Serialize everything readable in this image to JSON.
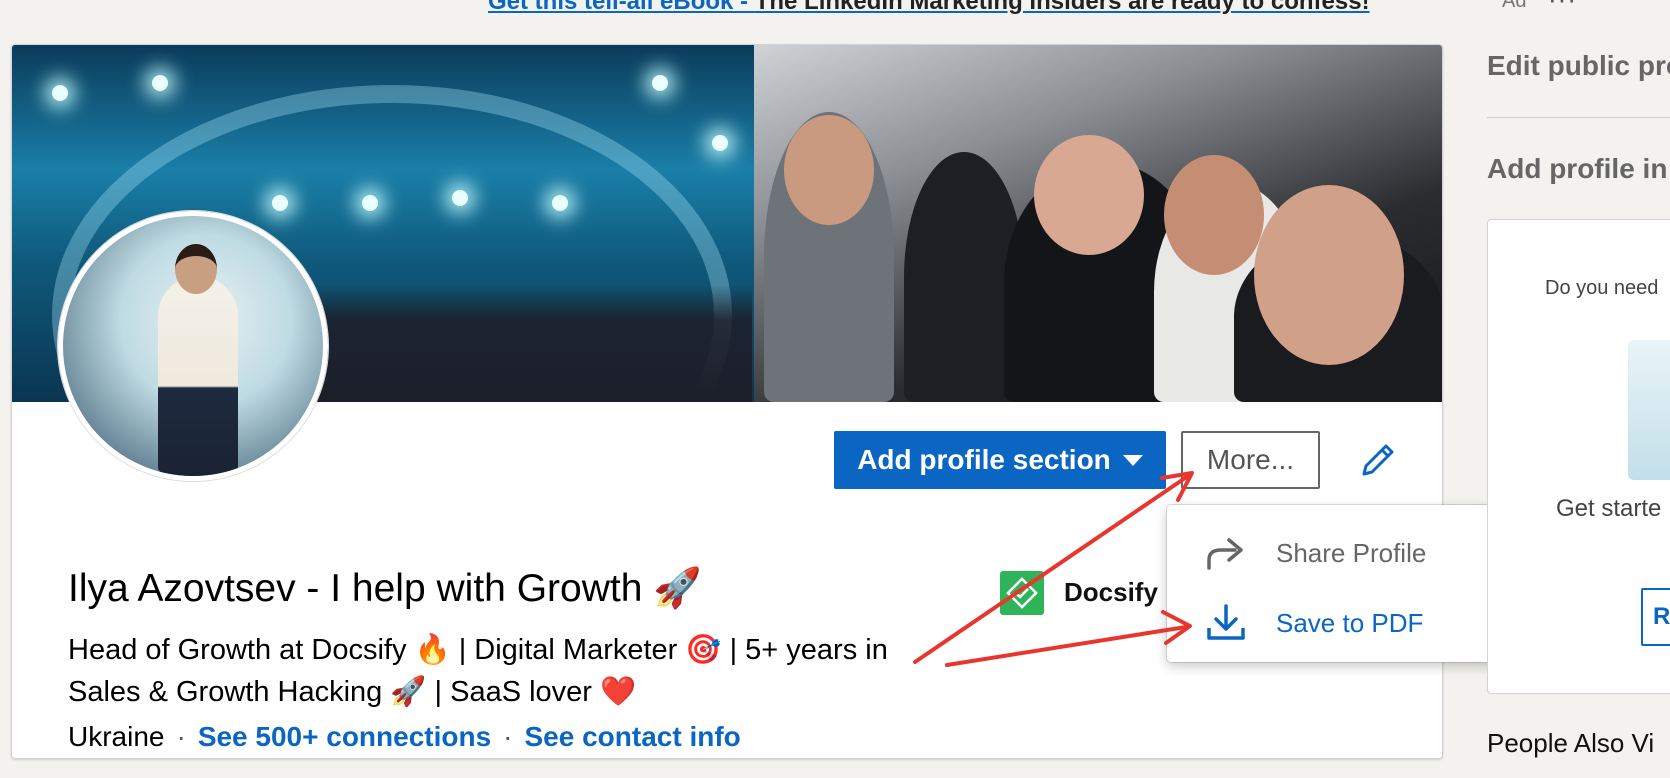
{
  "ad_banner": {
    "link_blue": "Get this tell-all eBook - ",
    "link_dark": "The LinkedIn Marketing Insiders are ready to confess!",
    "label": "Ad",
    "more": "···"
  },
  "profile": {
    "name": "Ilya Azovtsev - I help with Growth 🚀",
    "headline": "Head of Growth at Docsify 🔥  | Digital Marketer 🎯  | 5+ years in Sales & Growth Hacking 🚀 | SaaS lover ❤️",
    "location": "Ukraine",
    "connections_link": "See 500+ connections",
    "contact_link": "See contact info",
    "separator": "·"
  },
  "company": {
    "name": "Docsify"
  },
  "actions": {
    "add_section_label": "Add profile section",
    "more_label": "More..."
  },
  "more_menu": {
    "items": [
      {
        "label": "Share Profile",
        "icon": "share-icon"
      },
      {
        "label": "Save to PDF",
        "icon": "download-icon"
      }
    ]
  },
  "sidebar": {
    "edit_public_profile": "Edit public pro",
    "add_profile_language": "Add profile in",
    "ad_card": {
      "text": "Do you need",
      "caption": "Get starte",
      "button_label": "Re"
    },
    "people_also_viewed": "People Also Vi"
  },
  "colors": {
    "brand_blue": "#0a66c2",
    "annotation_red": "#e8362f",
    "docsify_green": "#2fb45a"
  }
}
